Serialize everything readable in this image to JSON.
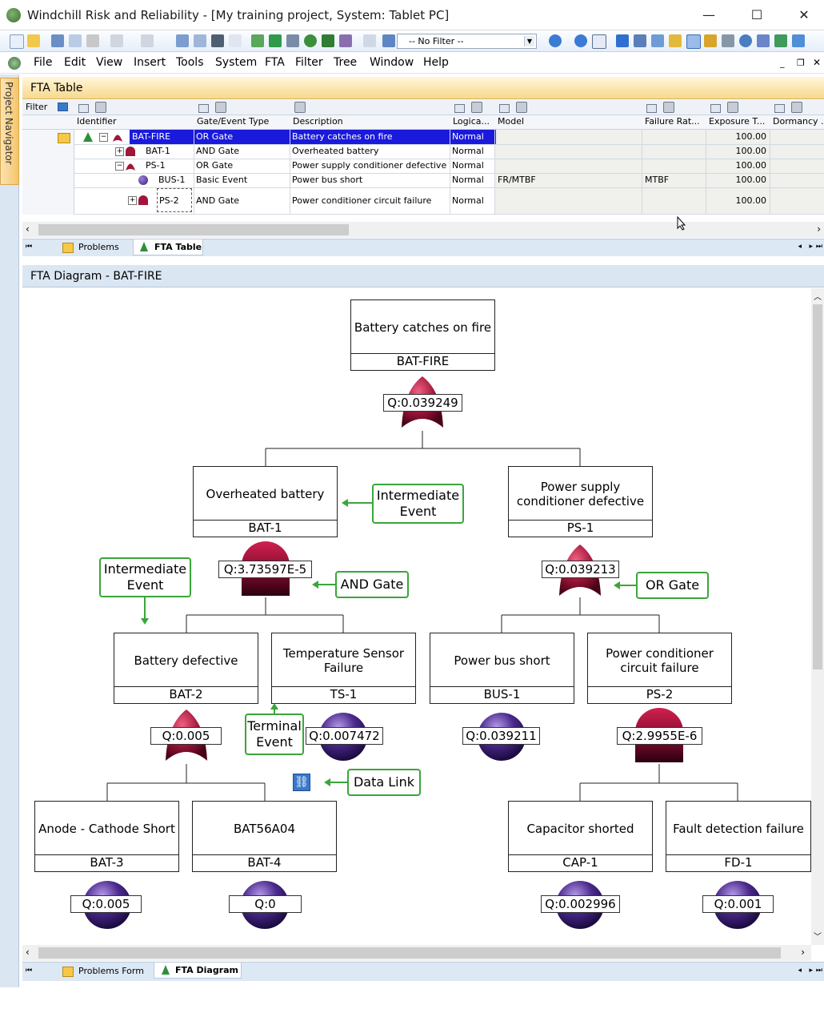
{
  "window": {
    "title": "Windchill Risk and Reliability - [My training project, System: Tablet PC]",
    "minimize": "—",
    "maximize": "☐",
    "close": "✕"
  },
  "toolbar": {
    "filter_value": "-- No Filter --"
  },
  "menu": {
    "items": [
      "File",
      "Edit",
      "View",
      "Insert",
      "Tools",
      "System",
      "FTA",
      "Filter",
      "Tree",
      "Window",
      "Help"
    ]
  },
  "navigator": {
    "label": "Project Navigator"
  },
  "fta_table": {
    "title": "FTA Table",
    "filter_label": "Filter",
    "columns": [
      "Identifier",
      "Gate/Event Type",
      "Description",
      "Logica...",
      "Model",
      "Failure Rat...",
      "Exposure T...",
      "Dormancy ..."
    ],
    "rows": [
      {
        "id": "BAT-FIRE",
        "type": "OR Gate",
        "desc": "Battery catches on fire",
        "logic": "Normal",
        "model": "",
        "rate": "",
        "exposure": "100.00",
        "selected": true
      },
      {
        "id": "BAT-1",
        "type": "AND Gate",
        "desc": "Overheated battery",
        "logic": "Normal",
        "model": "",
        "rate": "",
        "exposure": "100.00"
      },
      {
        "id": "PS-1",
        "type": "OR Gate",
        "desc": "Power supply conditioner defective",
        "logic": "Normal",
        "model": "",
        "rate": "",
        "exposure": "100.00"
      },
      {
        "id": "BUS-1",
        "type": "Basic Event",
        "desc": "Power bus short",
        "logic": "Normal",
        "model": "FR/MTBF",
        "rate": "MTBF",
        "exposure": "100.00"
      },
      {
        "id": "PS-2",
        "type": "AND Gate",
        "desc": "Power conditioner circuit failure",
        "logic": "Normal",
        "model": "",
        "rate": "",
        "exposure": "100.00"
      }
    ],
    "tabs": [
      "Problems",
      "FTA Table"
    ]
  },
  "fta_diagram": {
    "title": "FTA Diagram - BAT-FIRE",
    "nodes": {
      "bat_fire": {
        "desc": "Battery catches on fire",
        "id": "BAT-FIRE",
        "q": "Q:0.039249"
      },
      "bat_1": {
        "desc": "Overheated battery",
        "id": "BAT-1",
        "q": "Q:3.73597E-5"
      },
      "ps_1": {
        "desc": "Power supply conditioner defective",
        "id": "PS-1",
        "q": "Q:0.039213"
      },
      "bat_2": {
        "desc": "Battery defective",
        "id": "BAT-2",
        "q": "Q:0.005"
      },
      "ts_1": {
        "desc": "Temperature Sensor Failure",
        "id": "TS-1",
        "q": "Q:0.007472"
      },
      "bus_1": {
        "desc": "Power bus short",
        "id": "BUS-1",
        "q": "Q:0.039211"
      },
      "ps_2": {
        "desc": "Power conditioner circuit failure",
        "id": "PS-2",
        "q": "Q:2.9955E-6"
      },
      "bat_3": {
        "desc": "Anode - Cathode Short",
        "id": "BAT-3",
        "q": "Q:0.005"
      },
      "bat_4": {
        "desc": "BAT56A04",
        "id": "BAT-4",
        "q": "Q:0"
      },
      "cap_1": {
        "desc": "Capacitor shorted",
        "id": "CAP-1",
        "q": "Q:0.002996"
      },
      "fd_1": {
        "desc": "Fault detection failure",
        "id": "FD-1",
        "q": "Q:0.001"
      }
    },
    "callouts": {
      "intermediate_1": "Intermediate Event",
      "intermediate_2": "Intermediate Event",
      "and_gate": "AND Gate",
      "or_gate": "OR Gate",
      "terminal": "Terminal Event",
      "data_link": "Data Link"
    },
    "tabs": [
      "Problems Form",
      "FTA Diagram"
    ]
  },
  "colors": {
    "selection": "#1a1adc",
    "callout_border": "#3aa63a",
    "gate_red": "#a0163a",
    "event_purple": "#4b2a8c",
    "table_header": "#f7d98e"
  }
}
